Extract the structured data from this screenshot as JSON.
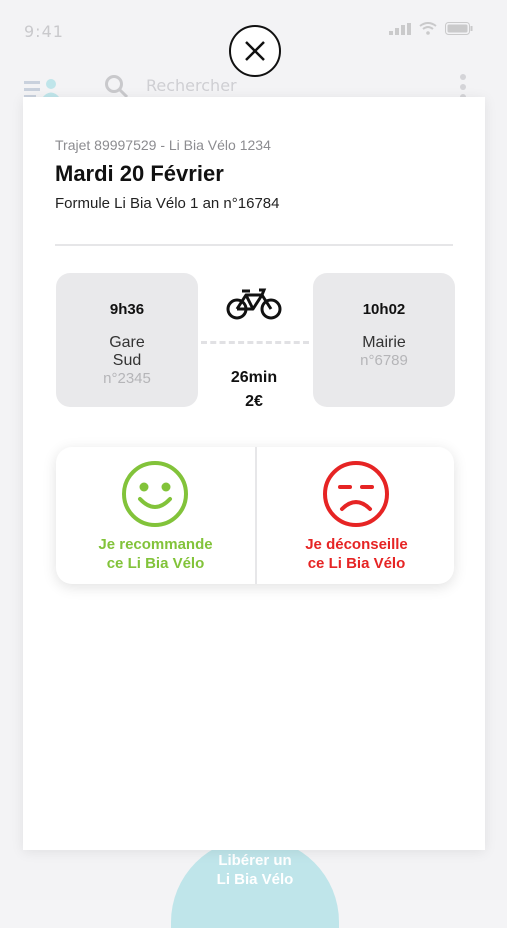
{
  "status_bar": {
    "time": "9:41"
  },
  "background": {
    "search_placeholder": "Rechercher",
    "release_button_line1": "Libérer un",
    "release_button_line2": "Li Bia Vélo"
  },
  "trip": {
    "id_line": "Trajet 89997529 - Li Bia Vélo 1234",
    "date": "Mardi 20 Février",
    "formula": "Formule Li Bia Vélo 1 an n°16784",
    "start": {
      "time": "9h36",
      "station_line1": "Gare",
      "station_line2": "Sud",
      "number": "n°2345"
    },
    "end": {
      "time": "10h02",
      "station_line1": "Mairie",
      "number": "n°6789"
    },
    "duration": "26min",
    "price": "2€"
  },
  "rating": {
    "recommend_line1": "Je recommande",
    "recommend_line2": "ce Li Bia Vélo",
    "discourage_line1": "Je déconseille",
    "discourage_line2": "ce Li Bia Vélo"
  },
  "colors": {
    "positive": "#82c33a",
    "negative": "#e62424",
    "release_button": "#bfe5ea"
  },
  "icons": [
    "close-icon",
    "bike-icon",
    "smile-icon",
    "frown-icon",
    "search-icon",
    "menu-icon",
    "more-icon"
  ]
}
